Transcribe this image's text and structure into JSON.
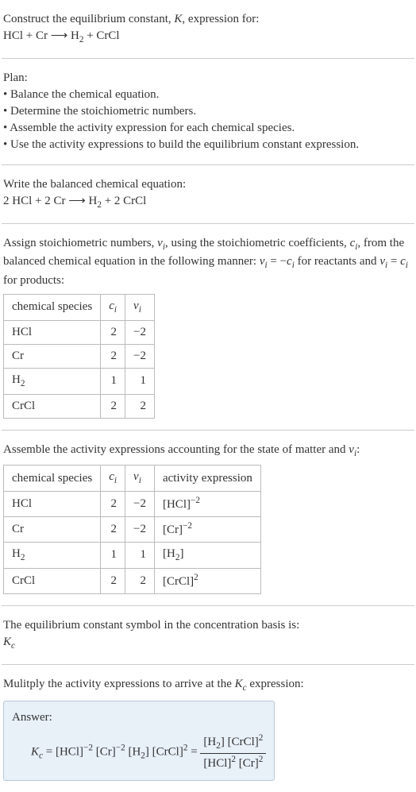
{
  "intro": {
    "line1_prefix": "Construct the equilibrium constant, ",
    "line1_K": "K",
    "line1_suffix": ", expression for:",
    "equation_lhs": "HCl + Cr ",
    "equation_arrow": "⟶",
    "equation_rhs_h2": " H",
    "equation_rhs_sub2": "2",
    "equation_rhs_end": " + CrCl"
  },
  "plan": {
    "header": "Plan:",
    "b1": "• Balance the chemical equation.",
    "b2": "• Determine the stoichiometric numbers.",
    "b3": "• Assemble the activity expression for each chemical species.",
    "b4": "• Use the activity expressions to build the equilibrium constant expression."
  },
  "balanced": {
    "header": "Write the balanced chemical equation:",
    "lhs": "2 HCl + 2 Cr ",
    "arrow": "⟶",
    "rhs_h2": " H",
    "rhs_sub2": "2",
    "rhs_end": " + 2 CrCl"
  },
  "stoich": {
    "text1": "Assign stoichiometric numbers, ",
    "nu_i": "ν",
    "sub_i": "i",
    "text2": ", using the stoichiometric coefficients, ",
    "c_i": "c",
    "text3": ", from the balanced chemical equation in the following manner: ",
    "eq1_lhs": "ν",
    "eq1_eq": " = −",
    "eq1_rhs": "c",
    "text4": " for reactants and ",
    "eq2_lhs": "ν",
    "eq2_eq": " = ",
    "eq2_rhs": "c",
    "text5": " for products:",
    "table": {
      "h1": "chemical species",
      "h2_c": "c",
      "h2_i": "i",
      "h3_nu": "ν",
      "h3_i": "i",
      "rows": [
        {
          "sp": "HCl",
          "c": "2",
          "nu": "−2"
        },
        {
          "sp": "Cr",
          "c": "2",
          "nu": "−2"
        },
        {
          "sp_h2": "H",
          "sp_sub": "2",
          "c": "1",
          "nu": "1"
        },
        {
          "sp": "CrCl",
          "c": "2",
          "nu": "2"
        }
      ]
    }
  },
  "activity": {
    "text1": "Assemble the activity expressions accounting for the state of matter and ",
    "nu": "ν",
    "sub_i": "i",
    "text2": ":",
    "table": {
      "h1": "chemical species",
      "h2_c": "c",
      "h2_i": "i",
      "h3_nu": "ν",
      "h3_i": "i",
      "h4": "activity expression",
      "rows": [
        {
          "sp": "HCl",
          "c": "2",
          "nu": "−2",
          "ae_br_l": "[HCl]",
          "ae_sup": "−2"
        },
        {
          "sp": "Cr",
          "c": "2",
          "nu": "−2",
          "ae_br_l": "[Cr]",
          "ae_sup": "−2"
        },
        {
          "sp_h2": "H",
          "sp_sub": "2",
          "c": "1",
          "nu": "1",
          "ae_br_l": "[H",
          "ae_s2": "2",
          "ae_close": "]"
        },
        {
          "sp": "CrCl",
          "c": "2",
          "nu": "2",
          "ae_br_l": "[CrCl]",
          "ae_sup": "2"
        }
      ]
    }
  },
  "kc_symbol": {
    "text": "The equilibrium constant symbol in the concentration basis is:",
    "K": "K",
    "c": "c"
  },
  "multiply": {
    "text1": "Mulitply the activity expressions to arrive at the ",
    "K": "K",
    "c": "c",
    "text2": " expression:"
  },
  "answer": {
    "label": "Answer:",
    "K": "K",
    "c": "c",
    "eq": " = ",
    "t1": "[HCl]",
    "e1": "−2",
    "t2": " [Cr]",
    "e2": "−2",
    "t3": " [H",
    "s2a": "2",
    "t4": "] [CrCl]",
    "e3": "2",
    "eq2": " = ",
    "num_t1": "[H",
    "num_s2": "2",
    "num_t2": "] [CrCl]",
    "num_e1": "2",
    "den_t1": "[HCl]",
    "den_e1": "2",
    "den_t2": " [Cr]",
    "den_e2": "2"
  }
}
